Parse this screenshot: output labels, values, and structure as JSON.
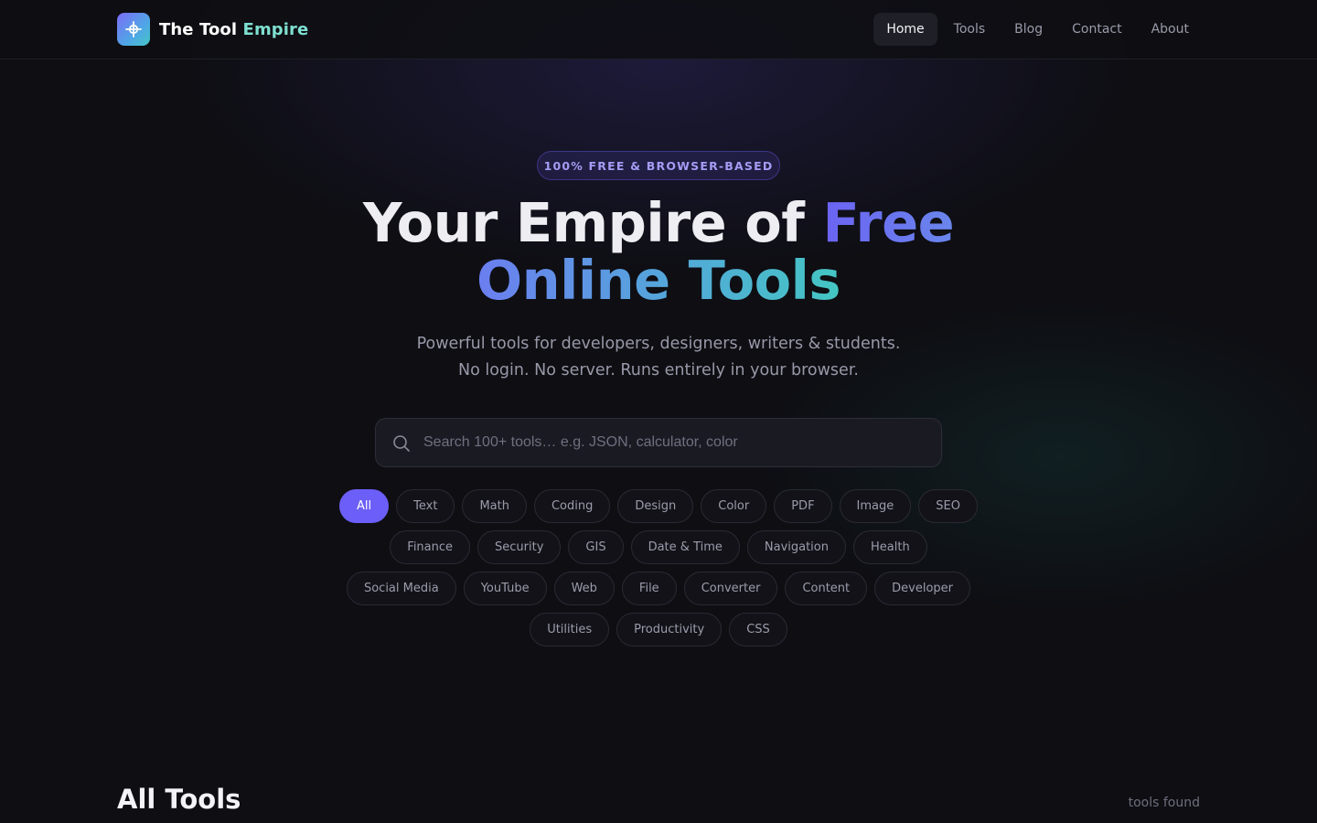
{
  "colors": {
    "background": "#0e0e13",
    "accent": "#6c5ef8",
    "teal": "#44c6c2",
    "badge_text": "#a49cf4"
  },
  "header": {
    "brand_icon": "crosshair-icon",
    "brand_word1": "The Tool",
    "brand_word2": "Empire",
    "nav": [
      {
        "label": "Home",
        "active": true
      },
      {
        "label": "Tools",
        "active": false
      },
      {
        "label": "Blog",
        "active": false
      },
      {
        "label": "Contact",
        "active": false
      },
      {
        "label": "About",
        "active": false
      }
    ]
  },
  "hero": {
    "badge": "100% FREE & BROWSER-BASED",
    "title_plain": "Your Empire of",
    "title_accent1": "Free",
    "title_accent2": "Online Tools",
    "subtitle_line1": "Powerful tools for developers, designers, writers & students.",
    "subtitle_line2": "No login. No server. Runs entirely in your browser."
  },
  "search": {
    "icon": "search-icon",
    "placeholder": "Search 100+ tools… e.g. JSON, calculator, color",
    "value": ""
  },
  "categories": {
    "selected": "All",
    "rows": [
      [
        "All",
        "Text",
        "Math",
        "Coding",
        "Design",
        "Color",
        "PDF",
        "Image",
        "SEO"
      ],
      [
        "Finance",
        "Security",
        "GIS",
        "Date & Time",
        "Navigation",
        "Health"
      ],
      [
        "Social Media",
        "YouTube",
        "Web",
        "File",
        "Converter",
        "Content",
        "Developer"
      ],
      [
        "Utilities",
        "Productivity",
        "CSS"
      ]
    ]
  },
  "tools_section": {
    "title": "All Tools",
    "count_text": "tools found"
  }
}
